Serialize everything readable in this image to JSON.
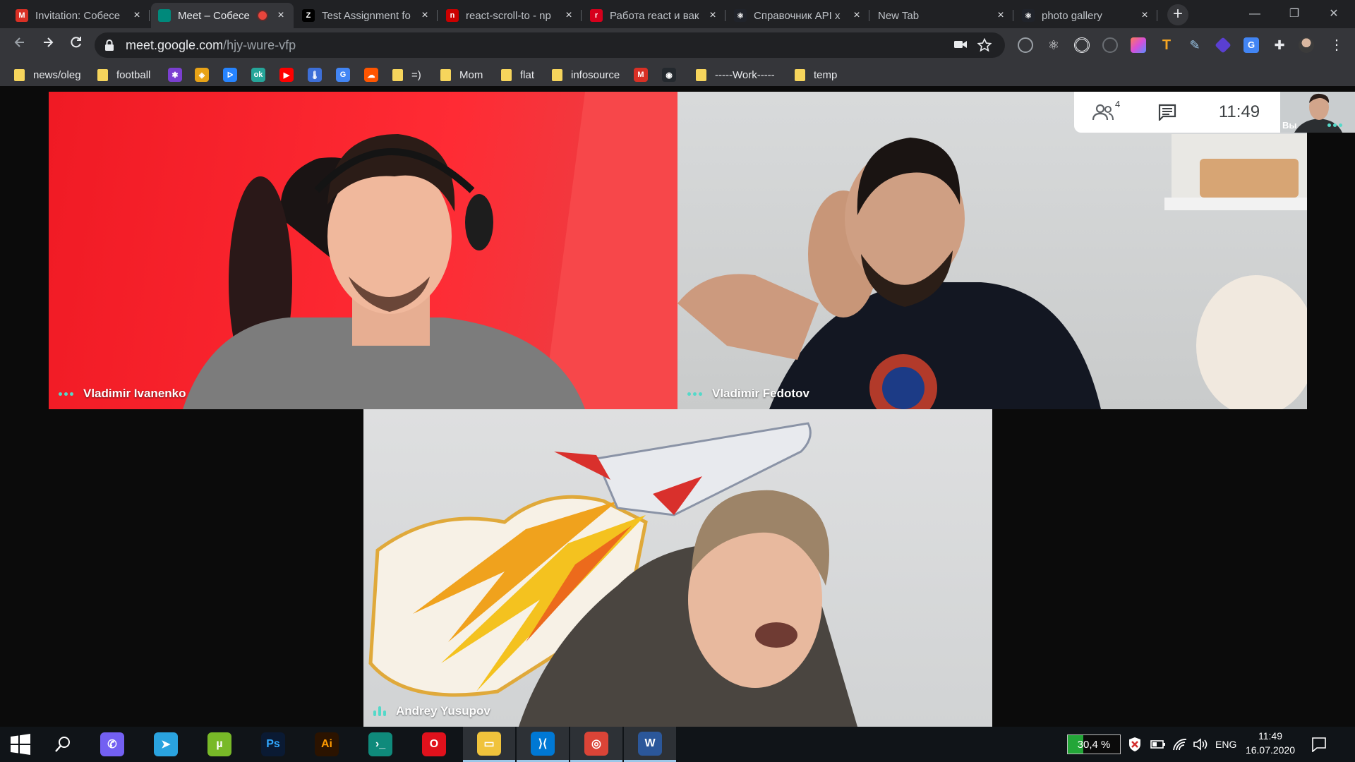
{
  "browser": {
    "tabs": [
      {
        "title": "Invitation: Собесе",
        "favicon": "gmail-icon",
        "color": "#d93025",
        "glyph": "M",
        "active": false
      },
      {
        "title": "Meet – Собесе",
        "favicon": "meet-icon",
        "color": "#00897b",
        "glyph": "",
        "active": true,
        "recording": true
      },
      {
        "title": "Test Assignment fo",
        "favicon": "zeplin-icon",
        "color": "#000000",
        "glyph": "Z",
        "active": false
      },
      {
        "title": "react-scroll-to - np",
        "favicon": "npm-icon",
        "color": "#cb0000",
        "glyph": "n",
        "active": false
      },
      {
        "title": "Работа react и вак",
        "favicon": "hh-icon",
        "color": "#d6001c",
        "glyph": "r",
        "active": false
      },
      {
        "title": "Справочник API х",
        "favicon": "react-icon",
        "color": "#20232a",
        "glyph": "⚛",
        "active": false
      },
      {
        "title": "New Tab",
        "favicon": "",
        "color": "",
        "glyph": "",
        "active": false
      },
      {
        "title": "photo gallery",
        "favicon": "react-icon",
        "color": "#20232a",
        "glyph": "⚛",
        "active": false
      }
    ],
    "new_tab": "+",
    "window_controls": {
      "minimize": "—",
      "restore": "❐",
      "close": "✕"
    },
    "url_host": "meet.google.com",
    "url_path": "/hjy-wure-vfp"
  },
  "bookmarks": [
    {
      "label": "news/oleg",
      "type": "folder"
    },
    {
      "label": "football",
      "type": "folder"
    },
    {
      "label": "",
      "type": "icon",
      "icon": "colorful-star-icon",
      "color": "#7b3fd1",
      "glyph": "✱"
    },
    {
      "label": "",
      "type": "icon",
      "icon": "badge-icon",
      "color": "#e8a317",
      "glyph": "◈"
    },
    {
      "label": "",
      "type": "icon",
      "icon": "jira-icon",
      "color": "#2684ff",
      "glyph": "ᐅ"
    },
    {
      "label": "",
      "type": "icon",
      "icon": "ok-icon",
      "color": "#26a69a",
      "glyph": "ok"
    },
    {
      "label": "",
      "type": "icon",
      "icon": "youtube-icon",
      "color": "#ff0000",
      "glyph": "▶"
    },
    {
      "label": "",
      "type": "icon",
      "icon": "thermometer-icon",
      "color": "#3d6fd8",
      "glyph": "🌡"
    },
    {
      "label": "",
      "type": "icon",
      "icon": "translate-icon",
      "color": "#4285f4",
      "glyph": "G"
    },
    {
      "label": "",
      "type": "icon",
      "icon": "soundcloud-icon",
      "color": "#ff5500",
      "glyph": "☁"
    },
    {
      "label": "=)",
      "type": "folder"
    },
    {
      "label": "Mom",
      "type": "folder"
    },
    {
      "label": "flat",
      "type": "folder"
    },
    {
      "label": "infosource",
      "type": "folder"
    },
    {
      "label": "",
      "type": "icon",
      "icon": "gmail-icon",
      "color": "#d93025",
      "glyph": "M"
    },
    {
      "label": "",
      "type": "icon",
      "icon": "github-icon",
      "color": "#24292e",
      "glyph": "◉"
    },
    {
      "label": "-----Work-----",
      "type": "folder"
    },
    {
      "label": "temp",
      "type": "folder"
    }
  ],
  "meet": {
    "participants": [
      {
        "name": "Vladimir Ivanenko",
        "indicator": "dots"
      },
      {
        "name": "Vladimir Fedotov",
        "indicator": "dots"
      },
      {
        "name": "Andrey Yusupov",
        "indicator": "bars"
      }
    ],
    "people_count": "4",
    "time": "11:49",
    "self_label": "Вы"
  },
  "taskbar": {
    "apps": [
      {
        "name": "viber",
        "color": "#7360f2",
        "glyph": "✆"
      },
      {
        "name": "telegram",
        "color": "#2aa3df",
        "glyph": "➤"
      },
      {
        "name": "utorrent",
        "color": "#78b928",
        "glyph": "µ"
      },
      {
        "name": "photoshop",
        "color": "#0a1a33",
        "glyph": "Ps",
        "fg": "#31a8ff"
      },
      {
        "name": "illustrator",
        "color": "#2b1300",
        "glyph": "Ai",
        "fg": "#ff9a00"
      },
      {
        "name": "terminal",
        "color": "#0f8a7b",
        "glyph": "›_"
      },
      {
        "name": "opera",
        "color": "#e0111c",
        "glyph": "O"
      },
      {
        "name": "file-explorer",
        "color": "#f0c33c",
        "glyph": "▭",
        "open": true
      },
      {
        "name": "vscode",
        "color": "#0078d4",
        "glyph": "⟩⟨",
        "open": true
      },
      {
        "name": "chrome",
        "color": "#db4437",
        "glyph": "◎",
        "open": true
      },
      {
        "name": "word",
        "color": "#2b579a",
        "glyph": "W",
        "open": true
      }
    ],
    "battery_text": "30,4 %",
    "battery_level": 0.304,
    "language": "ENG",
    "clock_time": "11:49",
    "clock_date": "16.07.2020"
  }
}
